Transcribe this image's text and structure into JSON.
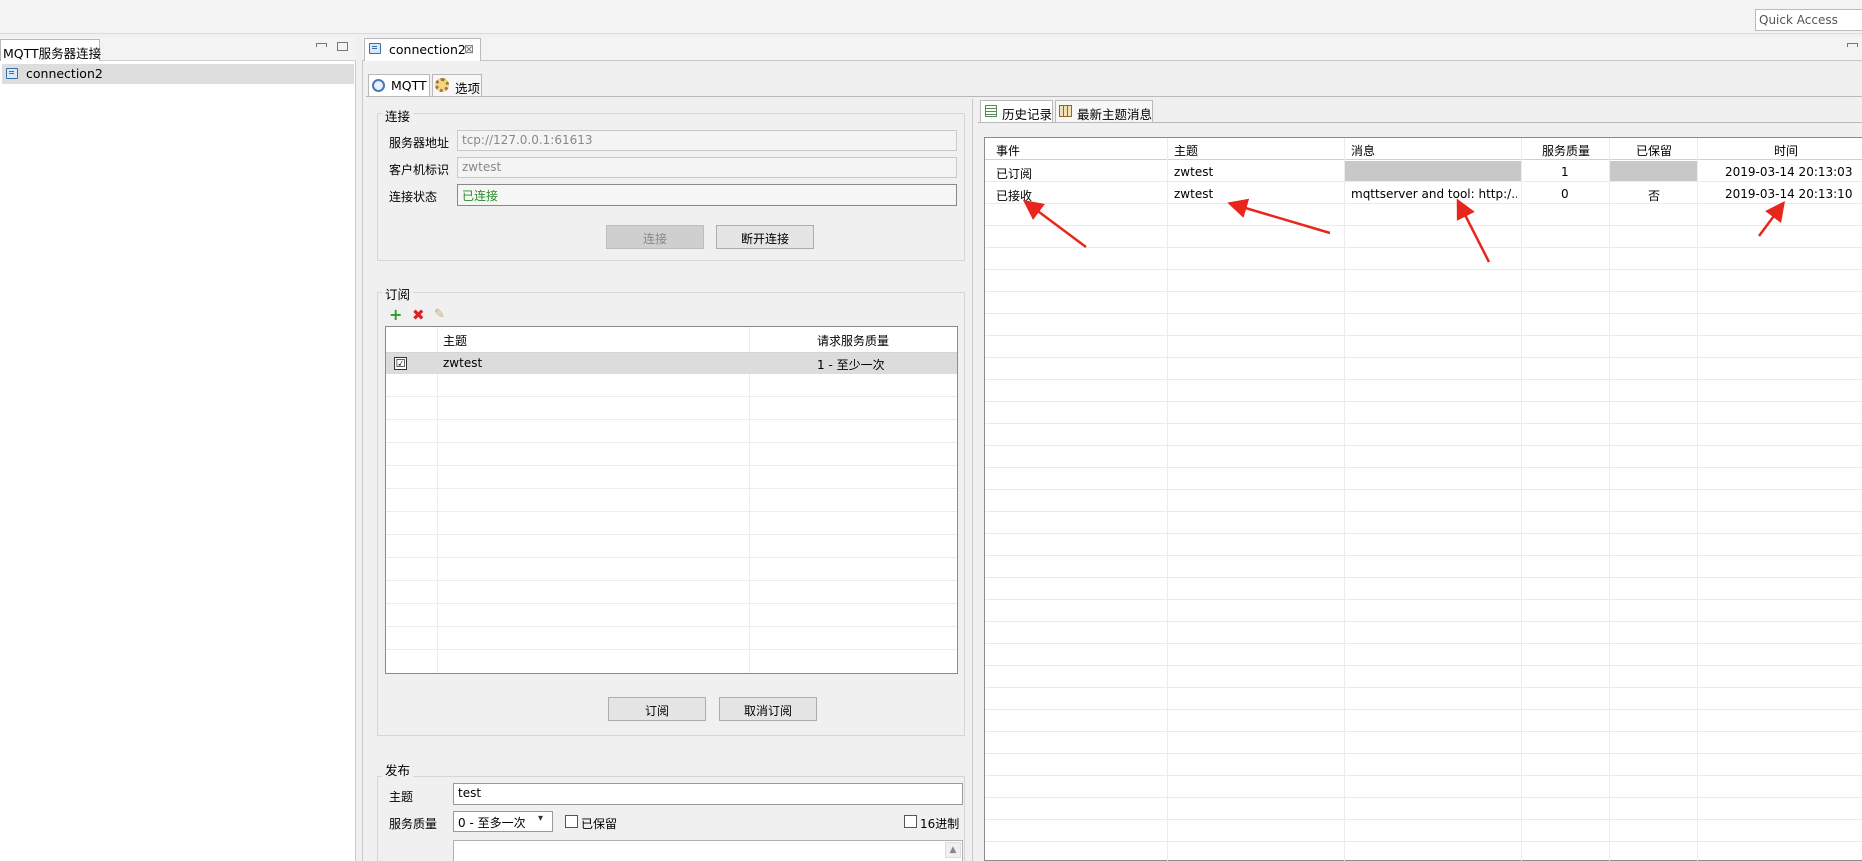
{
  "toolbar": {
    "quick_access": "Quick Access"
  },
  "left_view": {
    "tab_label": "MQTT服务器连接",
    "items": [
      {
        "label": "connection2"
      }
    ]
  },
  "editor": {
    "tab_label": "connection2",
    "close_glyph": "⊠",
    "subtabs": {
      "mqtt": "MQTT",
      "options": "选项"
    }
  },
  "connection": {
    "title": "连接",
    "server_label": "服务器地址",
    "server_value": "tcp://127.0.0.1:61613",
    "client_label": "客户机标识",
    "client_value": "zwtest",
    "status_label": "连接状态",
    "status_value": "已连接",
    "connect_button": "连接",
    "disconnect_button": "断开连接"
  },
  "subscribe": {
    "title": "订阅",
    "columns": [
      "主题",
      "请求服务质量"
    ],
    "rows": [
      {
        "checked": "☑",
        "topic": "zwtest",
        "qos": "1 - 至少一次"
      }
    ],
    "subscribe_button": "订阅",
    "unsubscribe_button": "取消订阅"
  },
  "publish": {
    "title": "发布",
    "topic_label": "主题",
    "topic_value": "test",
    "qos_label": "服务质量",
    "qos_selected": "0 - 至多一次",
    "retain_label": "已保留",
    "hex_label": "16进制"
  },
  "history": {
    "tab_history": "历史记录",
    "tab_latest": "最新主题消息",
    "columns": [
      "事件",
      "主题",
      "消息",
      "服务质量",
      "已保留",
      "时间"
    ],
    "rows": [
      {
        "event": "已订阅",
        "topic": "zwtest",
        "message": "",
        "qos": "1",
        "retained": "",
        "time": "2019-03-14 20:13:03"
      },
      {
        "event": "已接收",
        "topic": "zwtest",
        "message": "mqttserver and tool: http:/...",
        "qos": "0",
        "retained": "否",
        "time": "2019-03-14 20:13:10"
      }
    ]
  },
  "colors": {
    "arrow": "#e8261c",
    "status_green": "#2a8a2a",
    "selected_row": "#dddddd"
  }
}
